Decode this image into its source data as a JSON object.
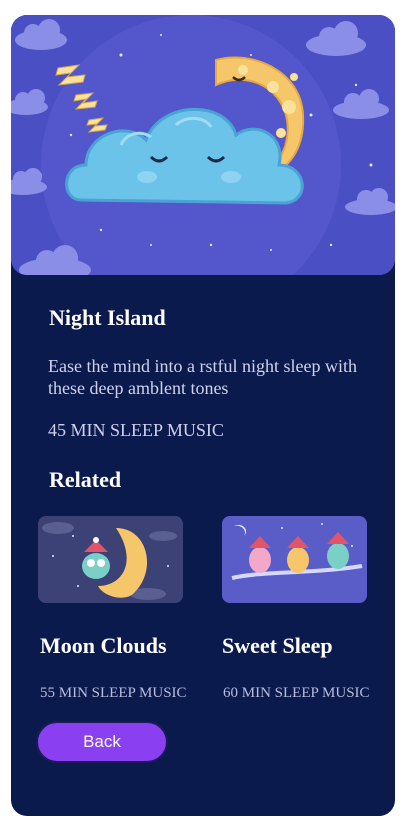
{
  "track": {
    "title": "Night Island",
    "description": "Ease the mind into a rstful night sleep with these deep amblent tones",
    "meta": "45 MIN SLEEP MUSIC"
  },
  "related": {
    "heading": "Related",
    "items": [
      {
        "title": "Moon Clouds",
        "meta": "55 MIN SLEEP MUSIC"
      },
      {
        "title": "Sweet Sleep",
        "meta": "60 MIN SLEEP MUSIC"
      }
    ]
  },
  "actions": {
    "back_label": "Back"
  },
  "colors": {
    "background": "#0b1a4d",
    "hero": "#4a4fc4",
    "accent": "#8a3ff0"
  },
  "icons": {
    "hero": "sleeping-cloud-moon-illustration",
    "card1": "moon-owl-illustration",
    "card2": "owls-on-branch-illustration"
  }
}
